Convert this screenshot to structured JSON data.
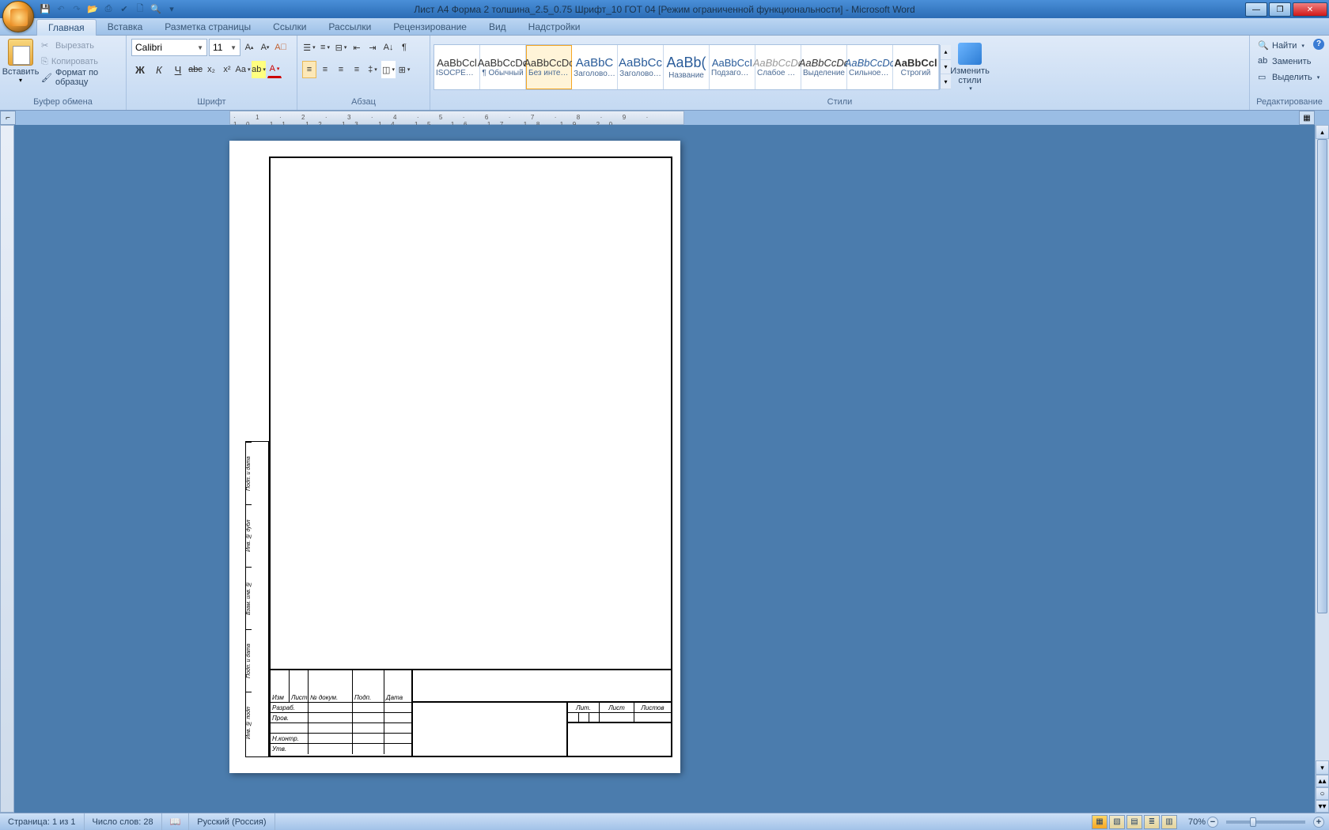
{
  "title": "Лист А4 Форма 2 толшина_2.5_0.75 Шрифт_10 ГОТ 04 [Режим ограниченной функциональности] - Microsoft Word",
  "tabs": {
    "home": "Главная",
    "insert": "Вставка",
    "layout": "Разметка страницы",
    "references": "Ссылки",
    "mailings": "Рассылки",
    "review": "Рецензирование",
    "view": "Вид",
    "addins": "Надстройки"
  },
  "clipboard": {
    "paste": "Вставить",
    "cut": "Вырезать",
    "copy": "Копировать",
    "format_painter": "Формат по образцу",
    "group": "Буфер обмена"
  },
  "font": {
    "family": "Calibri",
    "size": "11",
    "group": "Шрифт",
    "bold": "Ж",
    "italic": "К",
    "underline": "Ч"
  },
  "paragraph": {
    "group": "Абзац"
  },
  "styles": {
    "group": "Стили",
    "change": "Изменить стили",
    "items": [
      {
        "preview": "AaBbCcl",
        "name": "ISOCPEUR…",
        "cls": ""
      },
      {
        "preview": "AaBbCcDc",
        "name": "¶ Обычный",
        "cls": ""
      },
      {
        "preview": "AaBbCcDc",
        "name": "Без интер…",
        "cls": "selected"
      },
      {
        "preview": "AaBbC",
        "name": "Заголово…",
        "cls": "big blue"
      },
      {
        "preview": "AaBbCc",
        "name": "Заголово…",
        "cls": "big blue"
      },
      {
        "preview": "AaBb(",
        "name": "Название",
        "cls": "huge blue"
      },
      {
        "preview": "AaBbCcI",
        "name": "Подзагол…",
        "cls": "blue"
      },
      {
        "preview": "AaBbCcDc",
        "name": "Слабое в…",
        "cls": "ital gray"
      },
      {
        "preview": "AaBbCcDc",
        "name": "Выделение",
        "cls": "ital"
      },
      {
        "preview": "AaBbCcDc",
        "name": "Сильное …",
        "cls": "ital blue"
      },
      {
        "preview": "AaBbCcl",
        "name": "Строгий",
        "cls": "bold"
      }
    ]
  },
  "editing": {
    "find": "Найти",
    "replace": "Заменить",
    "select": "Выделить",
    "group": "Редактирование"
  },
  "statusbar": {
    "page": "Страница: 1 из 1",
    "words": "Число слов: 28",
    "lang": "Русский (Россия)",
    "zoom": "70%"
  },
  "title_block": {
    "headers": [
      "Изм",
      "Лист",
      "№ докум.",
      "Подп.",
      "Дата"
    ],
    "rows": [
      "Разраб.",
      "Пров.",
      "",
      "Н.контр.",
      "Утв."
    ],
    "right_headers": [
      "Лит.",
      "Лист",
      "Листов"
    ]
  },
  "side_block": [
    "Подп. и дата",
    "Инв. № дубл",
    "Взам. инв. №",
    "Подп. и дата",
    "Инв. № подп"
  ]
}
